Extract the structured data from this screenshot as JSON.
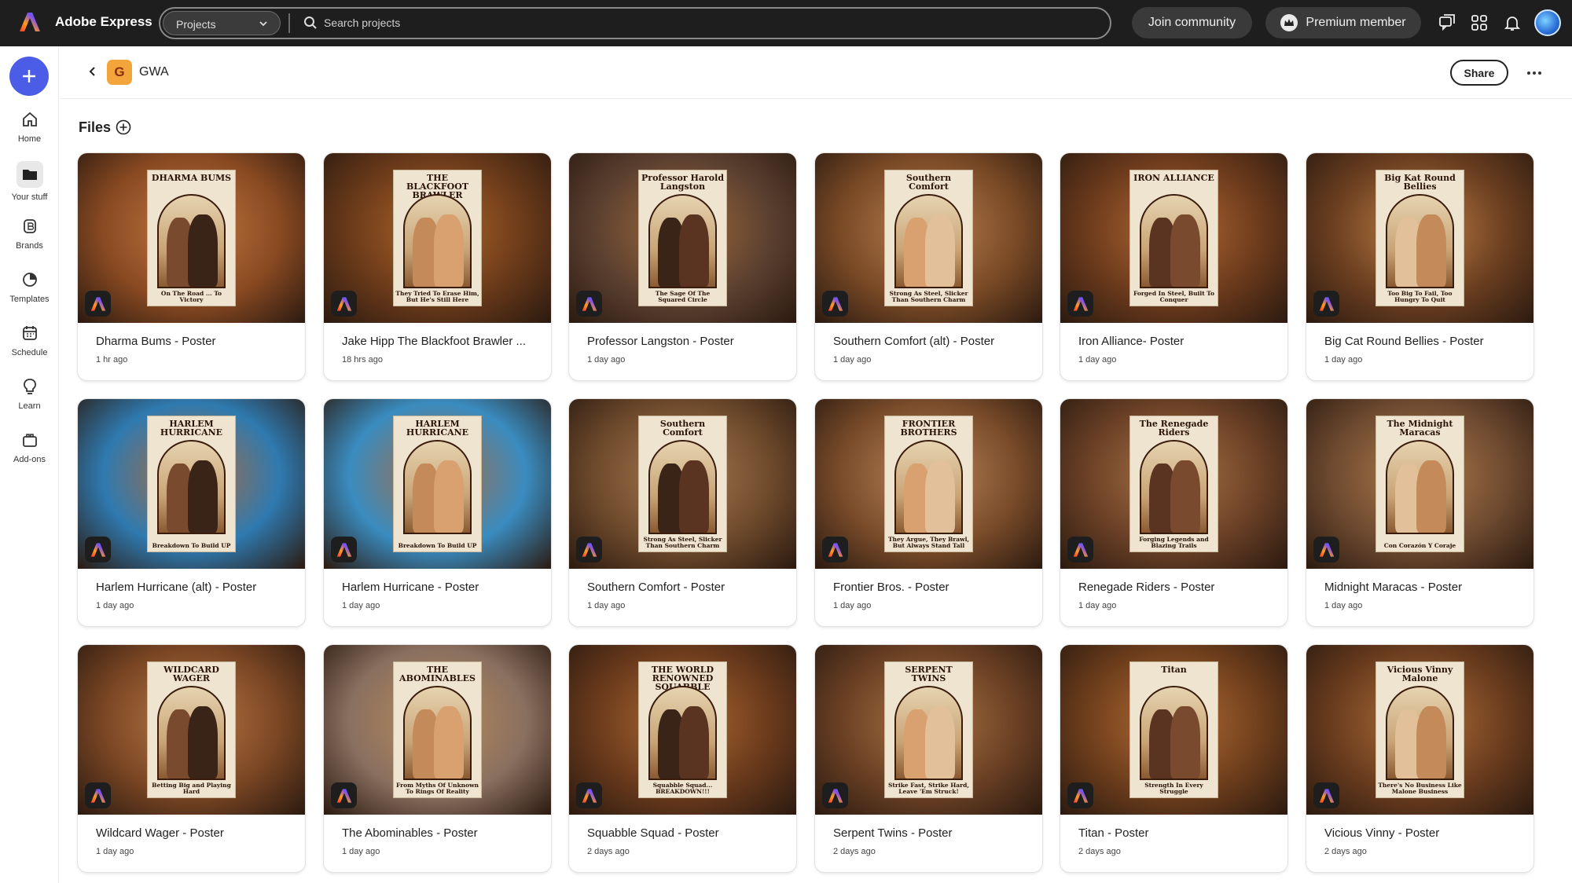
{
  "app": {
    "title": "Adobe Express",
    "brand_colors": [
      "#ff3b2f",
      "#ff9a1f",
      "#7a4df5",
      "#2aa6ff"
    ]
  },
  "topbar": {
    "project_select": "Projects",
    "search_placeholder": "Search projects",
    "join_label": "Join community",
    "premium_label": "Premium member"
  },
  "rail": {
    "items": [
      {
        "label": "Home",
        "icon": "home-icon"
      },
      {
        "label": "Your stuff",
        "icon": "folder-icon"
      },
      {
        "label": "Brands",
        "icon": "brand-icon"
      },
      {
        "label": "Templates",
        "icon": "templates-icon"
      },
      {
        "label": "Schedule",
        "icon": "calendar-icon"
      },
      {
        "label": "Learn",
        "icon": "lightbulb-icon"
      },
      {
        "label": "Add-ons",
        "icon": "addons-icon"
      }
    ]
  },
  "header": {
    "badge_letter": "G",
    "project_name": "GWA",
    "share_label": "Share"
  },
  "files": {
    "heading": "Files",
    "cards": [
      {
        "title": "Dharma Bums - Poster",
        "time": "1 hr ago",
        "poster_title": "DHARMA BUMS",
        "poster_tag": "On The Road ... To Victory",
        "bg": "#8a4a22",
        "bg2": "#c07a40"
      },
      {
        "title": "Jake Hipp The Blackfoot Brawler ...",
        "time": "18 hrs ago",
        "poster_title": "THE BLACKFOOT BRAWLER",
        "poster_tag": "They Tried To Erase Him, But He's Still Here",
        "bg": "#6a3a1a",
        "bg2": "#b0662a"
      },
      {
        "title": "Professor Langston - Poster",
        "time": "1 day ago",
        "poster_title": "Professor Harold Langston",
        "poster_tag": "The Sage Of The Squared Circle",
        "bg": "#5b4030",
        "bg2": "#a06a3a"
      },
      {
        "title": "Southern Comfort (alt) - Poster",
        "time": "1 day ago",
        "poster_title": "Southern Comfort",
        "poster_tag": "Strong As Steel, Slicker Than Southern Charm",
        "bg": "#7a4a26",
        "bg2": "#b88052"
      },
      {
        "title": "Iron Alliance- Poster",
        "time": "1 day ago",
        "poster_title": "IRON ALLIANCE",
        "poster_tag": "Forged In Steel, Built To Conquer",
        "bg": "#6b3a1c",
        "bg2": "#b46a34"
      },
      {
        "title": "Big Cat Round Bellies - Poster",
        "time": "1 day ago",
        "poster_title": "Big Kat Round Bellies",
        "poster_tag": "Too Big To Fail, Too Hungry To Quit",
        "bg": "#6a3e20",
        "bg2": "#c08046"
      },
      {
        "title": "Harlem Hurricane (alt) - Poster",
        "time": "1 day ago",
        "poster_title": "HARLEM HURRICANE",
        "poster_tag": "Breakdown To Build UP",
        "bg": "#2f7ab0",
        "bg2": "#b06a38"
      },
      {
        "title": "Harlem Hurricane - Poster",
        "time": "1 day ago",
        "poster_title": "HARLEM HURRICANE",
        "poster_tag": "Breakdown To Build UP",
        "bg": "#3a8cc0",
        "bg2": "#a86a3e"
      },
      {
        "title": "Southern Comfort - Poster",
        "time": "1 day ago",
        "poster_title": "Southern Comfort",
        "poster_tag": "Strong As Steel, Slicker Than Southern Charm",
        "bg": "#6e4a2c",
        "bg2": "#a87a52"
      },
      {
        "title": "Frontier Bros. - Poster",
        "time": "1 day ago",
        "poster_title": "FRONTIER BROTHERS",
        "poster_tag": "They Argue, They Brawl, But Always Stand Tall",
        "bg": "#7a4c2a",
        "bg2": "#b8865a"
      },
      {
        "title": "Renegade Riders - Poster",
        "time": "1 day ago",
        "poster_title": "The Renegade Riders",
        "poster_tag": "Forging Legends and Blazing Trails",
        "bg": "#6a4026",
        "bg2": "#ab7446"
      },
      {
        "title": "Midnight Maracas - Poster",
        "time": "1 day ago",
        "poster_title": "The Midnight Maracas",
        "poster_tag": "Con Corazón Y Coraje",
        "bg": "#6e4a30",
        "bg2": "#b07c4c"
      },
      {
        "title": "Wildcard Wager - Poster",
        "time": "1 day ago",
        "poster_title": "WILDCARD WAGER",
        "poster_tag": "Betting Big and Playing Hard",
        "bg": "#7a4624",
        "bg2": "#b87a46"
      },
      {
        "title": "The Abominables - Poster",
        "time": "1 day ago",
        "poster_title": "THE ABOMINABLES",
        "poster_tag": "From Myths Of Unknown To Rings Of Reality",
        "bg": "#8a7060",
        "bg2": "#b88a5a"
      },
      {
        "title": "Squabble Squad - Poster",
        "time": "2 days ago",
        "poster_title": "THE WORLD RENOWNED SQUABBLE SQUAD",
        "poster_tag": "Squabble Squad... BREAKDOWN!!!",
        "bg": "#6a3a1c",
        "bg2": "#ae6a32"
      },
      {
        "title": "Serpent Twins - Poster",
        "time": "2 days ago",
        "poster_title": "SERPENT TWINS",
        "poster_tag": "Strike Fast, Strike Hard, Leave 'Em Struck!",
        "bg": "#6a4024",
        "bg2": "#ac7444"
      },
      {
        "title": "Titan - Poster",
        "time": "2 days ago",
        "poster_title": "Titan",
        "poster_tag": "Strength In Every Struggle",
        "bg": "#6e3e1c",
        "bg2": "#b46e36"
      },
      {
        "title": "Vicious Vinny - Poster",
        "time": "2 days ago",
        "poster_title": "Vicious Vinny Malone",
        "poster_tag": "There's No Business Like Malone Business",
        "bg": "#6a3c1e",
        "bg2": "#b0703a"
      }
    ]
  }
}
